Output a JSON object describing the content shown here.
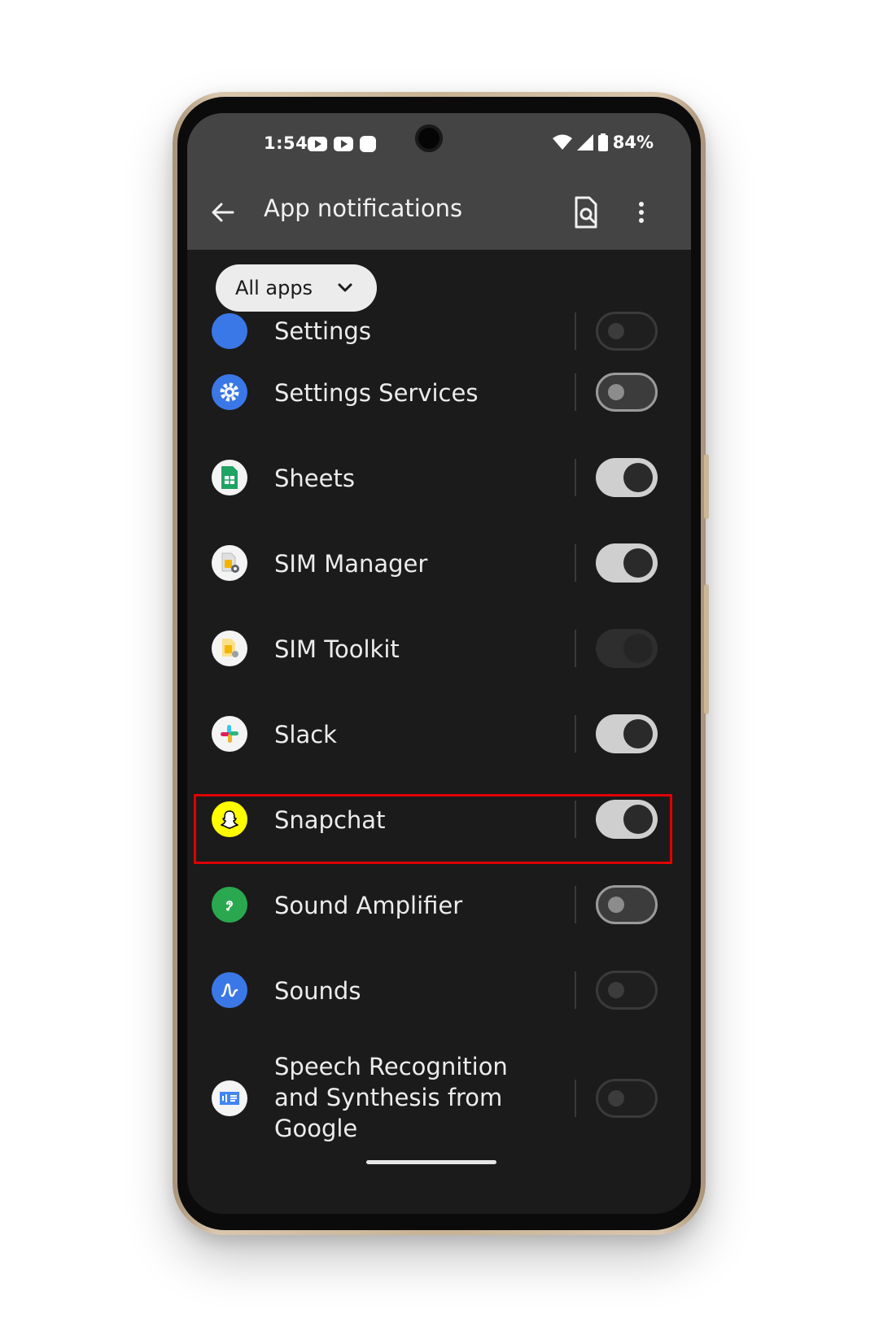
{
  "status_bar": {
    "time": "1:54",
    "battery": "84%"
  },
  "app_bar": {
    "title": "App notifications"
  },
  "filter": {
    "label": "All apps"
  },
  "colors": {
    "screen_bg": "#1b1b1b",
    "bar_bg": "#444444",
    "highlight": "#e00000",
    "settings_blue": "#3b78e7",
    "sheets_green": "#1fa463",
    "snapchat_yellow": "#fffc00",
    "sound_amp_green": "#2aa84f"
  },
  "apps": [
    {
      "label": "Settings",
      "icon": "settings-icon",
      "toggle": "off"
    },
    {
      "label": "Settings Services",
      "icon": "settings-gear-icon",
      "toggle": "off"
    },
    {
      "label": "Sheets",
      "icon": "sheets-icon",
      "toggle": "on"
    },
    {
      "label": "SIM Manager",
      "icon": "sim-manager-icon",
      "toggle": "on"
    },
    {
      "label": "SIM Toolkit",
      "icon": "sim-toolkit-icon",
      "toggle": "disabled-on"
    },
    {
      "label": "Slack",
      "icon": "slack-icon",
      "toggle": "on"
    },
    {
      "label": "Snapchat",
      "icon": "snapchat-icon",
      "toggle": "on"
    },
    {
      "label": "Sound Amplifier",
      "icon": "sound-amplifier-icon",
      "toggle": "off"
    },
    {
      "label": "Sounds",
      "icon": "sounds-icon",
      "toggle": "disabled-off"
    },
    {
      "label": "Speech Recognition and Synthesis from Google",
      "icon": "speech-services-icon",
      "toggle": "disabled-off"
    }
  ]
}
